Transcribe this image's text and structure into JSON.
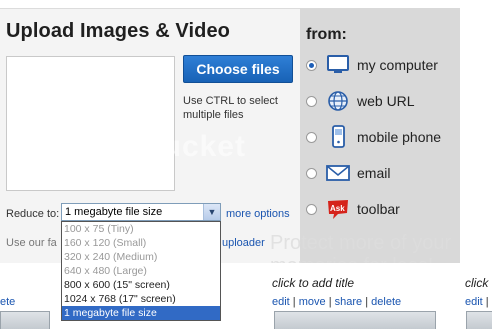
{
  "title": "Upload Images & Video",
  "choose_files_label": "Choose files",
  "ctrl_hint": "Use CTRL to select multiple files",
  "watermark": "photobucket",
  "watermark2": "Protect more of your memories for less!",
  "from_label": "from:",
  "sources": [
    {
      "label": "my computer",
      "icon": "monitor-icon",
      "selected": true
    },
    {
      "label": "web URL",
      "icon": "globe-icon",
      "selected": false
    },
    {
      "label": "mobile phone",
      "icon": "phone-icon",
      "selected": false
    },
    {
      "label": "email",
      "icon": "envelope-icon",
      "selected": false
    },
    {
      "label": "toolbar",
      "icon": "ask-logo-icon",
      "selected": false
    }
  ],
  "reduce": {
    "label": "Reduce to:",
    "selected": "1 megabyte file size",
    "more_options": "more options",
    "options": [
      {
        "text": "100 x 75 (Tiny)",
        "state": "dim"
      },
      {
        "text": "160 x 120 (Small)",
        "state": "dim"
      },
      {
        "text": "320 x 240 (Medium)",
        "state": "dim"
      },
      {
        "text": "640 x 480 (Large)",
        "state": "dim"
      },
      {
        "text": "800 x 600 (15\" screen)",
        "state": "normal"
      },
      {
        "text": "1024 x 768 (17\" screen)",
        "state": "normal"
      },
      {
        "text": "1 megabyte file size",
        "state": "selected"
      }
    ]
  },
  "use_text": "Use our fa",
  "uploader_link": "uploader",
  "bottom": {
    "left_delete": "ete",
    "card2_title": "click to add title",
    "card2_actions": [
      "edit",
      "move",
      "share",
      "delete"
    ],
    "card3_title": "click",
    "card3_actions": [
      "edit",
      "mo"
    ]
  },
  "colors": {
    "accent": "#1862b6",
    "source_bg": "#d9d9d9",
    "panel_bg": "#f4f4f4"
  }
}
